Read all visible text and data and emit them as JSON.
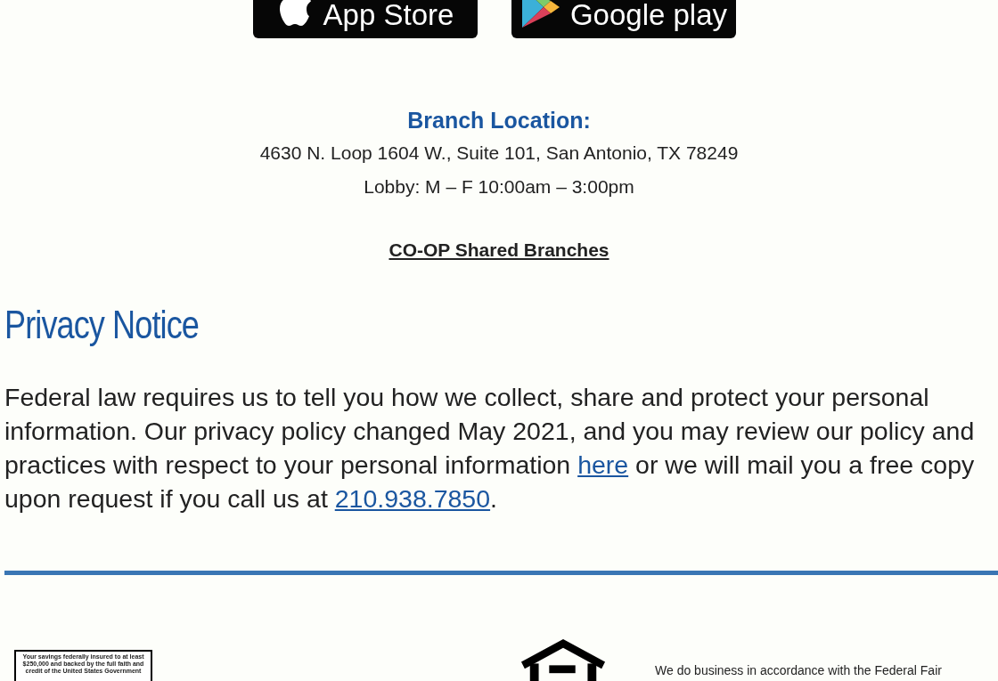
{
  "store_badges": [
    {
      "kind": "apple",
      "label": "App Store"
    },
    {
      "kind": "google",
      "label": "Google play"
    }
  ],
  "branch": {
    "heading": "Branch Location:",
    "address": "4630 N. Loop 1604 W., Suite 101, San Antonio, TX 78249",
    "hours": "Lobby: M – F 10:00am – 3:00pm",
    "link": "CO-OP Shared Branches"
  },
  "privacy": {
    "title": "Privacy Notice",
    "text_before": "Federal law requires us to tell you how we collect, share and protect your personal information. Our privacy policy changed May 2021, and you may review our policy and practices with respect to your personal information ",
    "link_1": "here",
    "text_middle": " or we will mail you a free copy upon request if you call us at ",
    "link_2": "210.938.7850",
    "text_after": "."
  },
  "footer": {
    "ncua_text": "Your savings federally insured to at least $250,000 and backed by the full faith and credit of the United States Government",
    "fair_lending_text": "We do business in accordance with the Federal Fair"
  }
}
